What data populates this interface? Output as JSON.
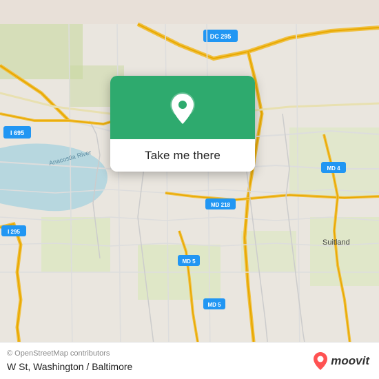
{
  "map": {
    "background_color": "#e8e0d8",
    "attribution": "© OpenStreetMap contributors"
  },
  "popup": {
    "button_label": "Take me there",
    "icon_name": "location-pin-icon"
  },
  "bottom_bar": {
    "attribution_text": "© OpenStreetMap contributors",
    "location_text": "W St, Washington / Baltimore",
    "logo_text": "moovit"
  },
  "road_labels": {
    "dc295": "DC 295",
    "i695": "I 695",
    "md4": "MD 4",
    "md218": "MD 218",
    "i295": "I 295",
    "md5_1": "MD 5",
    "md5_2": "MD 5",
    "anacostia": "Anacostia River",
    "suitland": "Suitland"
  }
}
